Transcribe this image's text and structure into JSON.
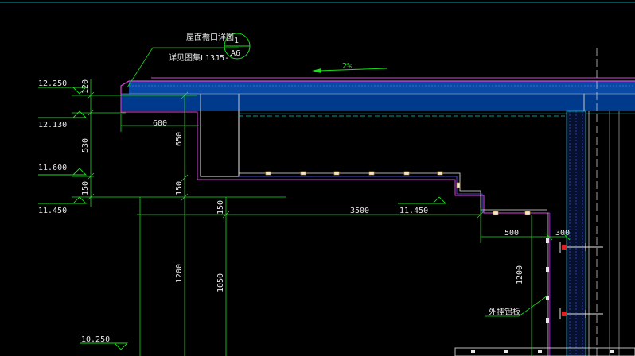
{
  "annotation": {
    "detail_title": "屋面檐口详图",
    "detail_ref": "详见图集L13J5-1",
    "circle_number": "1",
    "circle_sheet": "A6"
  },
  "slope_label": "2%",
  "elevations": {
    "e1": "12.250",
    "e2": "12.130",
    "e3": "11.600",
    "e4": "11.450",
    "e5": "10.250",
    "e6": "11.450"
  },
  "dimensions": {
    "d120": "120",
    "d530": "530",
    "d150a": "150",
    "d600": "600",
    "d650": "650",
    "d150b": "150",
    "d150c": "150",
    "d3500": "3500",
    "d500": "500",
    "d300": "300",
    "d1200a": "1200",
    "d1050": "1050",
    "d1200b": "1200"
  },
  "labels": {
    "cladding": "外挂铝板"
  },
  "colors": {
    "background": "#000000",
    "slab_fill": "#003a8c",
    "magenta": "#e040e0",
    "cyan": "#00c8c8",
    "green": "#19e019",
    "white": "#e8e8e8"
  }
}
